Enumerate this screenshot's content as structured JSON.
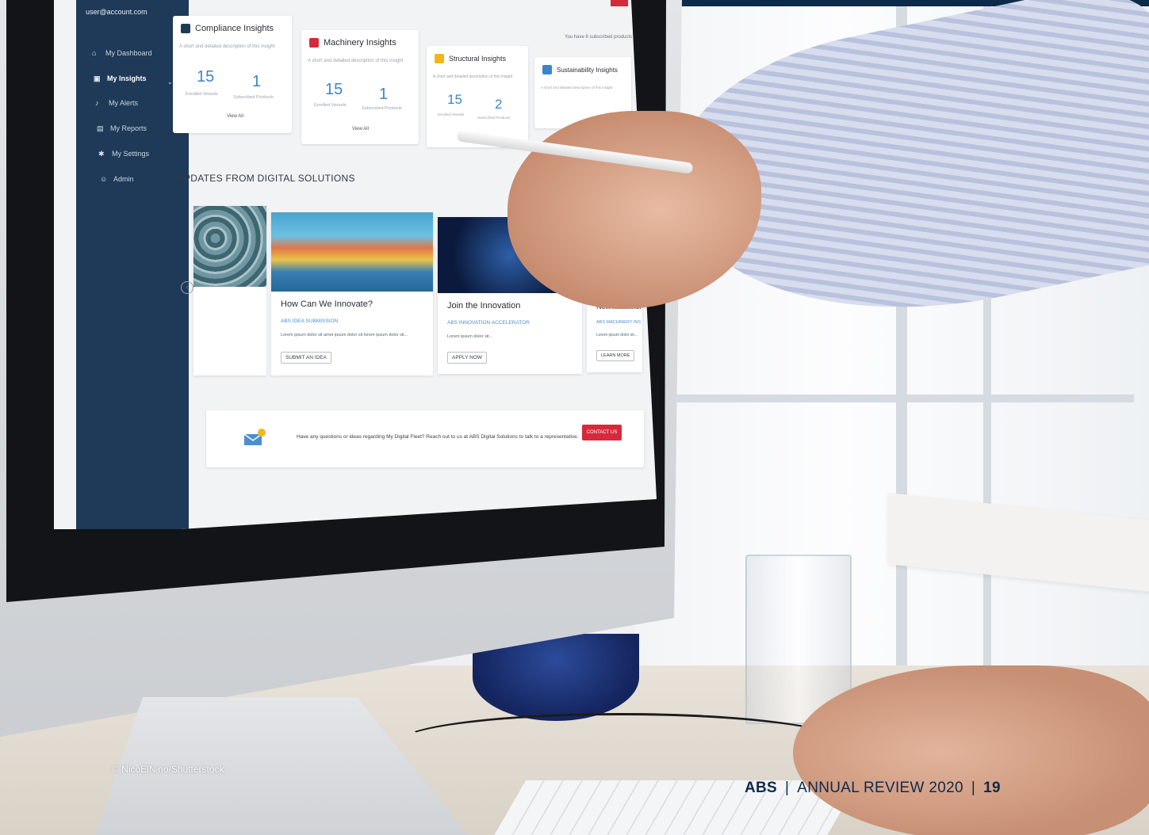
{
  "screen": {
    "user_email": "user@account.com",
    "sidebar": [
      {
        "label": "My Dashboard",
        "icon": "home-icon"
      },
      {
        "label": "My Insights",
        "icon": "insights-icon",
        "active": true
      },
      {
        "label": "My Alerts",
        "icon": "bell-icon"
      },
      {
        "label": "My Reports",
        "icon": "report-icon"
      },
      {
        "label": "My Settings",
        "icon": "gear-icon"
      },
      {
        "label": "Admin",
        "icon": "admin-icon"
      }
    ],
    "top_note": "You have 6 subscribed products",
    "insight_cards": [
      {
        "title": "Compliance Insights",
        "desc": "A short and detailed description of this insight",
        "value1": "15",
        "label1": "Enrolled Vessels",
        "value2": "1",
        "label2": "Subscribed Products",
        "view_all": "View All",
        "badge_color": "#1f3a58"
      },
      {
        "title": "Machinery Insights",
        "desc": "A short and detailed description of this insight",
        "value1": "15",
        "label1": "Enrolled Vessels",
        "value2": "1",
        "label2": "Subscribed Products",
        "view_all": "View All",
        "badge_color": "#d42a3a"
      },
      {
        "title": "Structural Insights",
        "desc": "A short and detailed description of this insight",
        "value1": "15",
        "label1": "Enrolled Vessels",
        "value2": "2",
        "label2": "Subscribed Products",
        "badge_color": "#f2b51d"
      },
      {
        "title": "Sustainability Insights",
        "desc": "A short and detailed description of this insight",
        "badge_color": "#3b86c9"
      }
    ],
    "section_title": "UPDATES FROM DIGITAL SOLUTIONS",
    "updates": [
      {
        "title": "How Can We Innovate?",
        "subtitle": "ABS IDEA SUBMISSION",
        "body": "Lorem ipsum dolor sit amet ipsum dolor sit lorem ipsum dolor sit...",
        "button": "SUBMIT AN IDEA"
      },
      {
        "title": "Join the Innovation",
        "subtitle": "ABS INNOVATION ACCELERATOR",
        "body": "Lorem ipsum dolor sit...",
        "button": "APPLY NOW"
      },
      {
        "title": "New Machinery",
        "subtitle": "ABS MACHINERY INS",
        "body": "Lorem ipsum dolor sit...",
        "button": "LEARN MORE"
      }
    ],
    "contact_text": "Have any questions or ideas regarding My Digital Fleet? Reach out to us at ABS Digital Solutions to talk to a representative.",
    "contact_button": "CONTACT US"
  },
  "credit": "© NicoElNino/Shutterstock",
  "footer": {
    "brand": "ABS",
    "separator": "|",
    "publication": "ANNUAL REVIEW 2020",
    "page": "19"
  },
  "colors": {
    "navy": "#0e2a4d",
    "accent_red": "#d42a3a",
    "accent_blue": "#3b86c9"
  }
}
